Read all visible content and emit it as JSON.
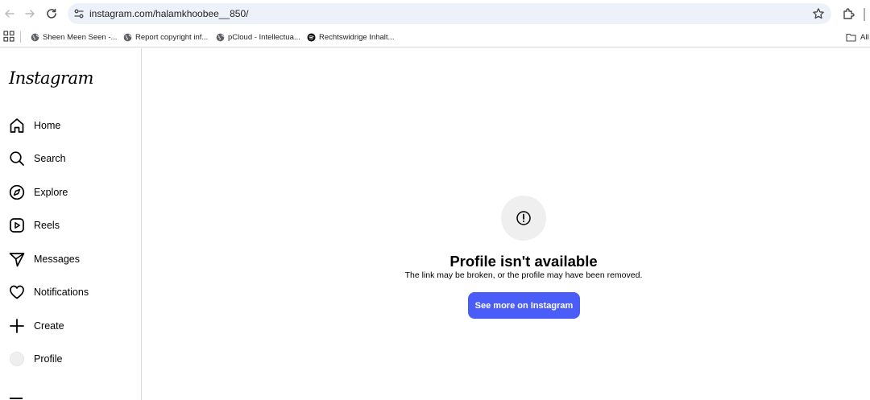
{
  "browser": {
    "url": "instagram.com/halamkhoobee__850/",
    "bookmarks": [
      {
        "label": "Sheen Meen Seen -...",
        "icon": "globe-icon"
      },
      {
        "label": "Report copyright inf...",
        "icon": "globe-icon"
      },
      {
        "label": "pCloud - Intellectua...",
        "icon": "globe-icon"
      },
      {
        "label": "Rechtswidrige Inhalt...",
        "icon": "spotify-icon"
      }
    ],
    "all_bookmarks_label": "All"
  },
  "sidebar": {
    "logo": "Instagram",
    "items": [
      {
        "label": "Home",
        "icon": "home-icon"
      },
      {
        "label": "Search",
        "icon": "search-icon"
      },
      {
        "label": "Explore",
        "icon": "compass-icon"
      },
      {
        "label": "Reels",
        "icon": "reels-icon"
      },
      {
        "label": "Messages",
        "icon": "messages-icon"
      },
      {
        "label": "Notifications",
        "icon": "heart-icon"
      },
      {
        "label": "Create",
        "icon": "plus-icon"
      },
      {
        "label": "Profile",
        "icon": "avatar"
      }
    ]
  },
  "main": {
    "title": "Profile isn't available",
    "subtitle": "The link may be broken, or the profile may have been removed.",
    "button_label": "See more on Instagram"
  },
  "colors": {
    "accent": "#4a5df9",
    "omnibox": "#edf2fa",
    "border": "#dbdbdb"
  }
}
